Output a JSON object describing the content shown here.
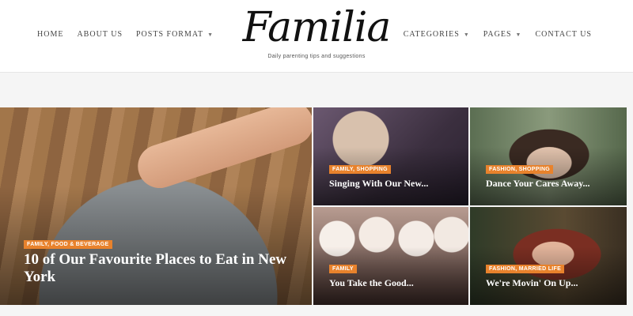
{
  "header": {
    "nav_left": [
      "HOME",
      "ABOUT US",
      "POSTS FORMAT"
    ],
    "nav_right": [
      "CATEGORIES",
      "PAGES",
      "CONTACT US"
    ],
    "logo": "Familia",
    "tagline": "Daily parenting tips and suggestions"
  },
  "featured": {
    "main": {
      "category": "FAMILY, FOOD & BEVERAGE",
      "title": "10 of Our Favourite Places to Eat in New York"
    },
    "tiles": [
      {
        "category": "FAMILY, SHOPPING",
        "title": "Singing With Our New..."
      },
      {
        "category": "FASHION, SHOPPING",
        "title": "Dance Your Cares Away..."
      },
      {
        "category": "FAMILY",
        "title": "You Take the Good..."
      },
      {
        "category": "FASHION, MARRIED LIFE",
        "title": "We're Movin' On Up..."
      }
    ]
  },
  "colors": {
    "accent": "#e8822c"
  }
}
